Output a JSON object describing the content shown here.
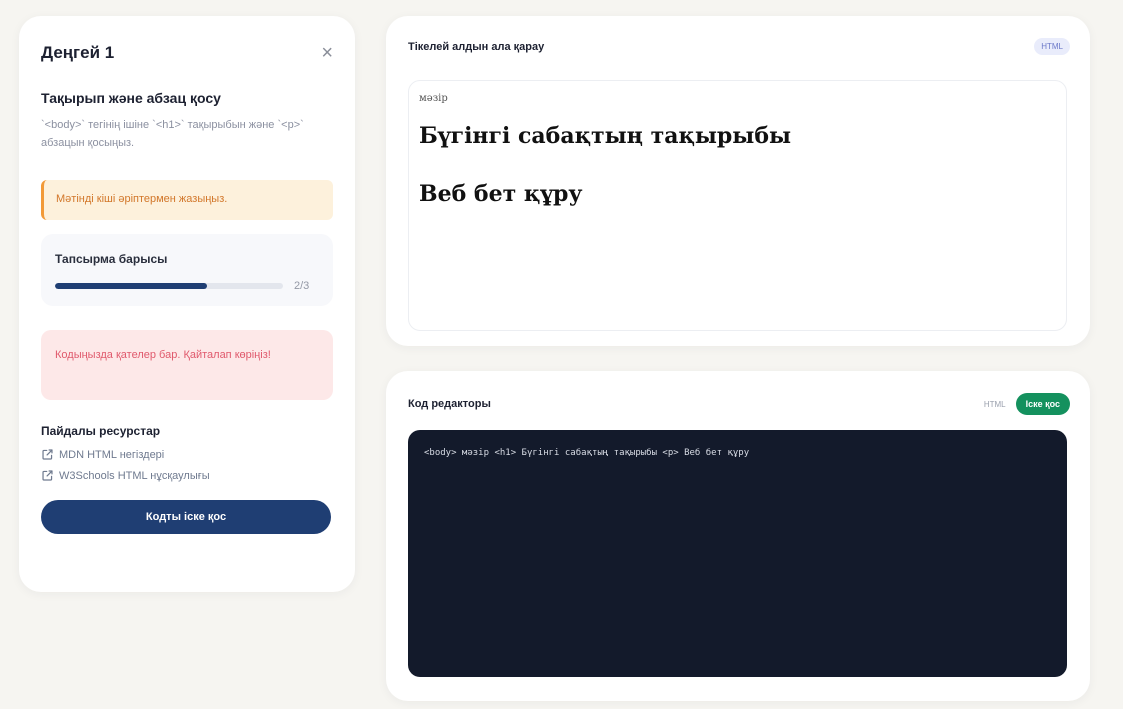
{
  "task": {
    "level_title": "Деңгей 1",
    "title": "Тақырып және абзац қосу",
    "description": "`<body>` тегінің ішіне `<h1>` тақырыбын және `<p>` абзацын қосыңыз.",
    "hint": "Мәтінді кіші әріптермен жазыңыз.",
    "progress": {
      "label": "Тапсырма барысы",
      "text": "2/3",
      "fraction": 0.667
    },
    "error": "Кодыңызда қателер бар. Қайталап көріңіз!",
    "resources": {
      "title": "Пайдалы ресурстар",
      "links": [
        {
          "label": "MDN HTML негіздері"
        },
        {
          "label": "W3Schools HTML нұсқаулығы"
        }
      ]
    },
    "run_button": "Кодты іске қос"
  },
  "preview": {
    "title": "Тікелей алдын ала қарау",
    "badge": "HTML",
    "small_text": "мәзір",
    "heading": "Бүгінгі сабақтың тақырыбы",
    "paragraph": "Веб бет құру"
  },
  "editor": {
    "title": "Код редакторы",
    "language": "HTML",
    "run_button": "Іске қос",
    "code": "<body> мәзір <h1> Бүгінгі сабақтың тақырыбы <p> Веб бет құру"
  },
  "colors": {
    "accent": "#1f3e73",
    "run": "#14915e",
    "hint_bg": "#fdf1dc",
    "hint_border": "#f29a38",
    "error_bg": "#fde8e8",
    "error_text": "#e0596c",
    "code_bg": "#131a2b"
  }
}
